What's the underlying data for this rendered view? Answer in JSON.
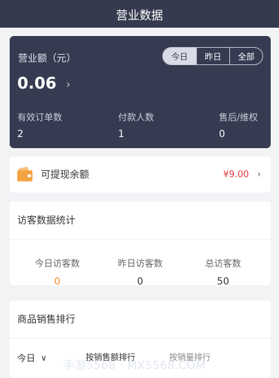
{
  "header": {
    "title": "营业数据"
  },
  "revenue": {
    "label": "营业额（元）",
    "tabs": [
      "今日",
      "昨日",
      "全部"
    ],
    "active_tab": 0,
    "amount": "0.06",
    "stats": [
      {
        "label": "有效订单数",
        "value": "2"
      },
      {
        "label": "付款人数",
        "value": "1"
      },
      {
        "label": "售后/维权",
        "value": "0"
      }
    ]
  },
  "wallet": {
    "label": "可提现余额",
    "amount": "¥9.00"
  },
  "visitors": {
    "title": "访客数据统计",
    "items": [
      {
        "label": "今日访客数",
        "value": "0"
      },
      {
        "label": "昨日访客数",
        "value": "0"
      },
      {
        "label": "总访客数",
        "value": "50"
      }
    ]
  },
  "ranking": {
    "title": "商品销售排行",
    "period": "今日",
    "sort_by_amount": "按销售额排行",
    "sort_by_volume": "按销量排行"
  },
  "watermark": "手游5568 · MX5568.COM",
  "colors": {
    "header": "#353a4e",
    "accent_red": "#e4393c",
    "accent_orange": "#f08a24"
  },
  "icons": {
    "wallet": "wallet-icon",
    "chevron": "chevron-right-icon",
    "dropdown": "chevron-down-icon"
  }
}
